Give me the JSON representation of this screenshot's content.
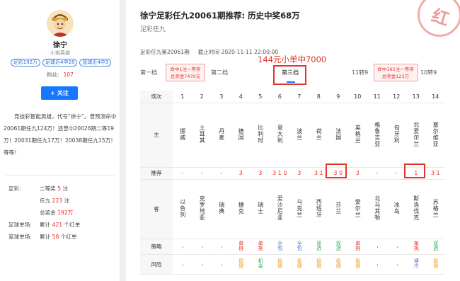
{
  "profile": {
    "name": "徐宁",
    "title": "小炮英雄",
    "badges": [
      "足彩192万",
      "足球近4中28",
      "篮球近4中3"
    ],
    "fans_label": "粉丝:",
    "fans_count": "107",
    "follow_label": "+ 关注",
    "bio": "竞技彩智能英雄，代号“徐宁”。曾预测命中20061期任九124万！还曾中20026期二等19万！20031期任九17万！20038期任九15万！等等！",
    "stats": {
      "zucai_label": "足彩:",
      "second_prize_pre": "二等奖 ",
      "second_prize_num": "5",
      "second_prize_unit": " 注",
      "renjiu_pre": "任九 ",
      "renjiu_num": "223",
      "renjiu_unit": " 注",
      "total_pre": "总奖金 ",
      "total_num": "192万",
      "football_label": "足球单场:",
      "football_pre": "累计 ",
      "football_num": "421",
      "football_unit": " 个红单",
      "basketball_label": "篮球单场:",
      "basketball_pre": "累计 ",
      "basketball_num": "58",
      "basketball_unit": " 个红单"
    }
  },
  "article": {
    "title": "徐宁足彩任九20061期推荐: 历史中奖68万",
    "subtitle": "足彩任九",
    "stamp_text": "红",
    "meta_issue": "足彩任九第20061期",
    "meta_time": "截止时间 2020-11-11 22:00:00",
    "annotation": "144元小单中7000"
  },
  "tabs": {
    "t1": "第一档",
    "t2": "第二档",
    "t3": "第三档",
    "t4": "11转9",
    "t5": "10转9",
    "bubble1_line1": "命中1注一等奖",
    "bubble1_line2": "总奖金7470元",
    "bubble2_line1": "命中165注一等奖",
    "bubble2_line2": "总奖金123万"
  },
  "table": {
    "head_label": "场次",
    "host_label": "主",
    "rec_label": "推荐",
    "guest_label": "客",
    "strat_label": "策略",
    "risk_label": "风险",
    "numbers": [
      "1",
      "2",
      "3",
      "4",
      "5",
      "6",
      "7",
      "8",
      "9",
      "10",
      "11",
      "12",
      "13",
      "14"
    ],
    "hosts": [
      "挪威",
      "土耳其",
      "丹麦",
      "德国",
      "比利时",
      "意大利",
      "波兰",
      "荷兰",
      "法国",
      "英格兰",
      "格鲁吉亚",
      "匈牙利",
      "北爱尔兰",
      "塞尔维亚"
    ],
    "recs": [
      "-",
      "-",
      "-",
      "3",
      "3",
      "3 1 0",
      "3",
      "3 1",
      "3 0",
      "3",
      "-",
      "-",
      "1",
      "3 1"
    ],
    "guests": [
      "以色列",
      "克罗地亚",
      "瑞典",
      "捷克",
      "瑞士",
      "爱沙尼亚",
      "乌克兰",
      "西班牙",
      "芬兰",
      "爱尔兰",
      "北马其顿",
      "冰岛",
      "斯洛伐克",
      "苏格兰"
    ],
    "strats": [
      "-",
      "-",
      "-",
      "单挑",
      "单挑",
      "全包",
      "全包",
      "双选",
      "双选",
      "单挑",
      "-",
      "-",
      "单挑",
      "双选"
    ],
    "risks": [
      "-",
      "-",
      "-",
      "稳健",
      "机会",
      "稳健",
      "稳健",
      "稳健",
      "稳健",
      "稳健",
      "-",
      "-",
      "博冷",
      "稳健"
    ]
  },
  "colors": {
    "accent_blue": "#1677ff",
    "red": "#e5332a",
    "green": "#2aa84a",
    "orange": "#f0a020",
    "purple": "#7c5cc4"
  }
}
